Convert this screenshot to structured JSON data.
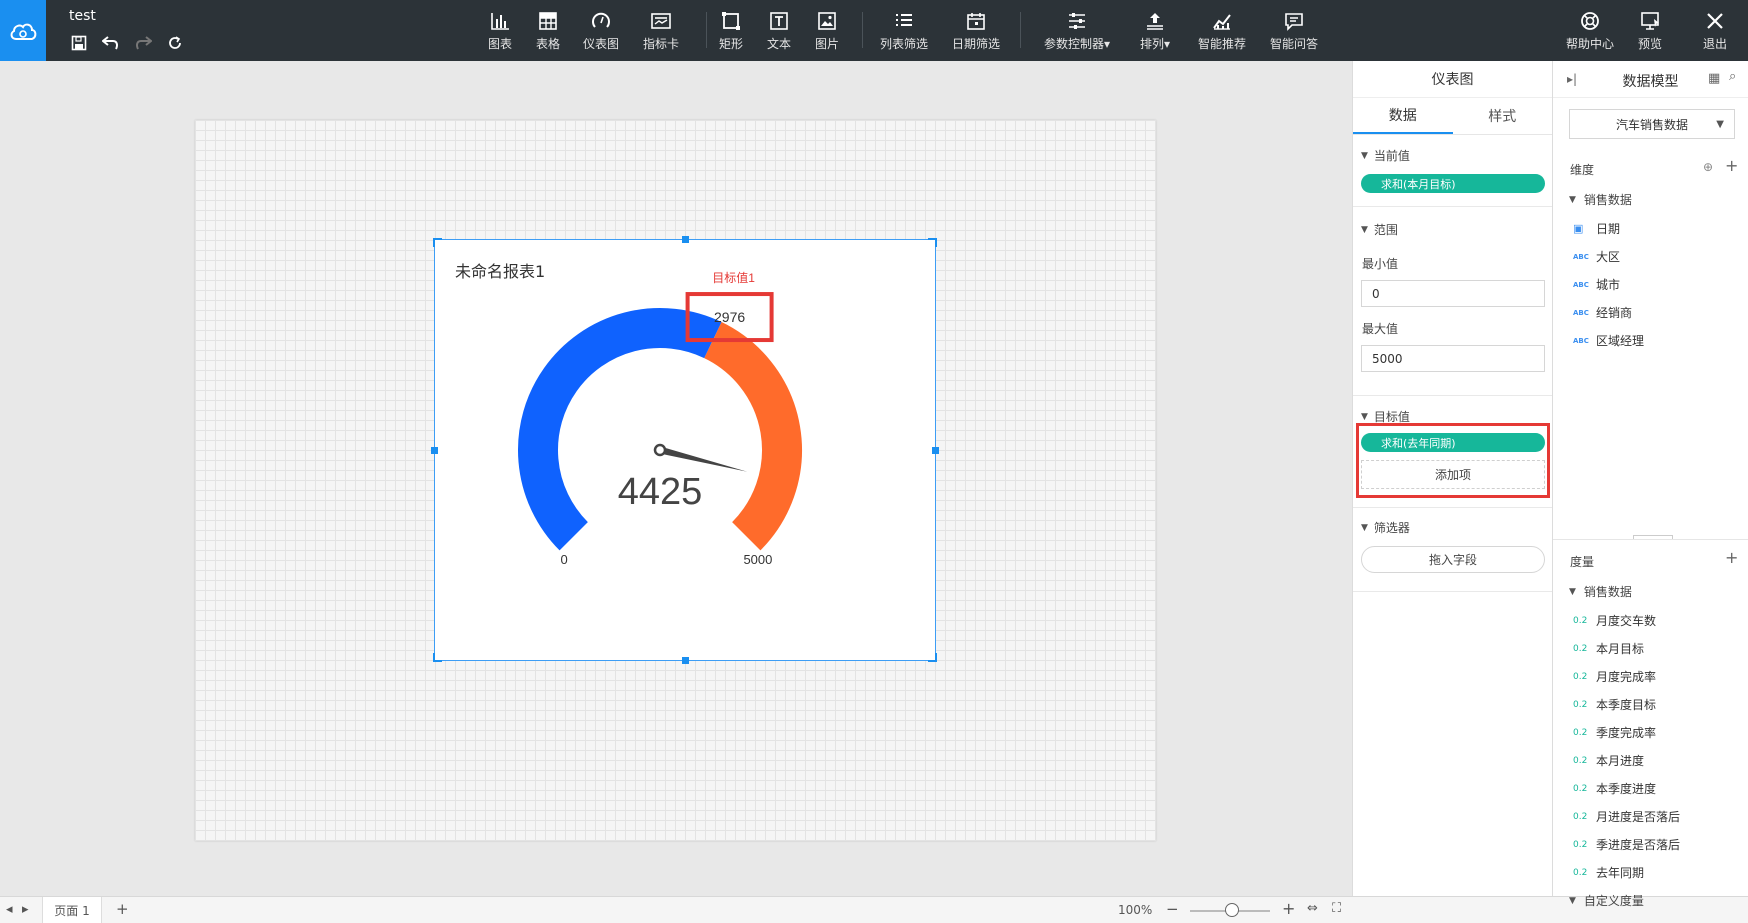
{
  "app": {
    "doc_title": "test"
  },
  "toolbar": {
    "items": [
      {
        "label": "图表",
        "icon": "bar-chart-icon"
      },
      {
        "label": "表格",
        "icon": "table-icon"
      },
      {
        "label": "仪表图",
        "icon": "gauge-icon"
      },
      {
        "label": "指标卡",
        "icon": "kpi-card-icon"
      },
      {
        "label": "矩形",
        "icon": "rectangle-icon"
      },
      {
        "label": "文本",
        "icon": "text-icon"
      },
      {
        "label": "图片",
        "icon": "image-icon"
      },
      {
        "label": "列表筛选",
        "icon": "list-filter-icon"
      },
      {
        "label": "日期筛选",
        "icon": "date-filter-icon"
      },
      {
        "label": "参数控制器",
        "icon": "param-control-icon"
      },
      {
        "label": "排列",
        "icon": "arrange-icon"
      },
      {
        "label": "智能推荐",
        "icon": "smart-recommend-icon"
      },
      {
        "label": "智能问答",
        "icon": "smart-qa-icon"
      }
    ],
    "right_items": [
      {
        "label": "帮助中心",
        "icon": "help-icon"
      },
      {
        "label": "预览",
        "icon": "preview-icon"
      },
      {
        "label": "退出",
        "icon": "close-icon"
      }
    ]
  },
  "widget": {
    "title": "未命名报表1",
    "target_label": "目标值1",
    "target_value": "2976",
    "current_value": "4425",
    "min_label": "0",
    "max_label": "5000"
  },
  "chart_data": {
    "type": "gauge",
    "title": "未命名报表1",
    "min": 0,
    "max": 5000,
    "value": 4425,
    "target": 2976,
    "target_label": "目标值1",
    "colors": {
      "achieved": "#0f62fe",
      "remaining": "#ff6b2b",
      "target_label": "#e53935"
    }
  },
  "bottom": {
    "page_tab": "页面 1",
    "add_page": "+",
    "zoom": "100%",
    "zoom_level": 1.0
  },
  "config_panel": {
    "title": "仪表图",
    "tabs": [
      "数据",
      "样式"
    ],
    "current_value": {
      "title": "当前值",
      "pill": "求和(本月目标)"
    },
    "range": {
      "title": "范围",
      "min_label": "最小值",
      "min_value": "0",
      "max_label": "最大值",
      "max_value": "5000"
    },
    "target": {
      "title": "目标值",
      "pill": "求和(去年同期)",
      "add": "添加项"
    },
    "filter": {
      "title": "筛选器",
      "drop": "拖入字段"
    }
  },
  "model_panel": {
    "title": "数据模型",
    "dataset": "汽车销售数据",
    "dimensions": {
      "title": "维度",
      "group": "销售数据",
      "items": [
        {
          "label": "日期",
          "type": "date"
        },
        {
          "label": "大区",
          "type": "ABC"
        },
        {
          "label": "城市",
          "type": "ABC"
        },
        {
          "label": "经销商",
          "type": "ABC"
        },
        {
          "label": "区域经理",
          "type": "ABC"
        }
      ]
    },
    "measures": {
      "title": "度量",
      "group": "销售数据",
      "items": [
        "月度交车数",
        "本月目标",
        "月度完成率",
        "本季度目标",
        "季度完成率",
        "本月进度",
        "本季度进度",
        "月进度是否落后",
        "季进度是否落后",
        "去年同期"
      ],
      "type_label": "0.2",
      "custom_group": "自定义度量"
    }
  }
}
